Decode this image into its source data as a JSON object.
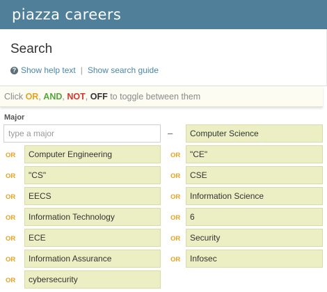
{
  "header": {
    "logo": "piazza careers"
  },
  "search": {
    "title": "Search",
    "help_label": "Show help text",
    "separator": "|",
    "guide_label": "Show search guide"
  },
  "toggle_hint": {
    "prefix": "Click",
    "or": "OR",
    "comma1": ",",
    "and": "AND",
    "comma2": ",",
    "not": "NOT",
    "comma3": ",",
    "off": "OFF",
    "suffix": "to toggle between them"
  },
  "major": {
    "label": "Major",
    "placeholder": "type a major",
    "dash": "–",
    "first_tag": "Computer Science",
    "rows": [
      {
        "left_op": "OR",
        "left": "Computer Engineering",
        "right_op": "OR",
        "right": "\"CE\""
      },
      {
        "left_op": "OR",
        "left": "\"CS\"",
        "right_op": "OR",
        "right": "CSE"
      },
      {
        "left_op": "OR",
        "left": "EECS",
        "right_op": "OR",
        "right": "Information Science"
      },
      {
        "left_op": "OR",
        "left": "Information Technology",
        "right_op": "OR",
        "right": "6"
      },
      {
        "left_op": "OR",
        "left": "ECE",
        "right_op": "OR",
        "right": "Security"
      },
      {
        "left_op": "OR",
        "left": "Information Assurance",
        "right_op": "OR",
        "right": "Infosec"
      },
      {
        "left_op": "OR",
        "left": "cybersecurity"
      }
    ]
  },
  "colors": {
    "header_bg": "#4f7f99",
    "tag_bg": "#ecefc4",
    "or": "#e8a320",
    "and": "#52a83a",
    "not": "#d8352b",
    "link": "#4a86a8"
  }
}
